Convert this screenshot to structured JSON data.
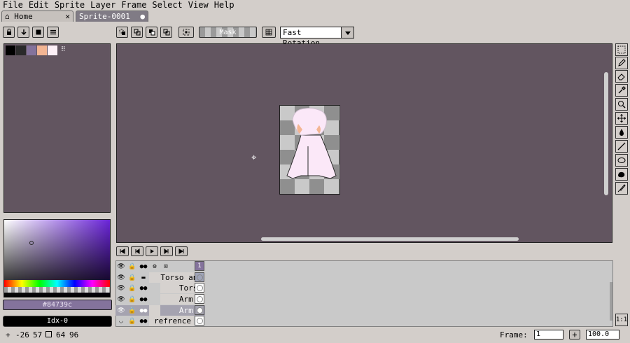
{
  "menu": [
    "File",
    "Edit",
    "Sprite",
    "Layer",
    "Frame",
    "Select",
    "View",
    "Help"
  ],
  "tabs": [
    {
      "label": "Home",
      "close": "✕"
    },
    {
      "label": "Sprite-0001",
      "close": "●"
    }
  ],
  "toolbar": {
    "mask_label": "Mask",
    "rotation_mode": "Fast Rotation"
  },
  "palette": {
    "swatch_colors": [
      "#000000",
      "#2a2a2a",
      "#84739c",
      "#f3b593",
      "#fdf0f7"
    ],
    "more": "⠿"
  },
  "color": {
    "hex": "#84739c",
    "index": "Idx-0"
  },
  "canvas": {
    "background": "#625560",
    "crosshair": "⌖"
  },
  "timeline": {
    "controls": [
      "first-frame",
      "previous-frame",
      "play",
      "next-frame",
      "last-frame"
    ],
    "frame_header": "1",
    "layers": [
      {
        "name": "Torso and",
        "type": "group",
        "selected": false
      },
      {
        "name": "Torso",
        "type": "layer",
        "selected": false
      },
      {
        "name": "Arm A",
        "type": "layer",
        "selected": false
      },
      {
        "name": "Arm B",
        "type": "layer",
        "selected": true
      },
      {
        "name": "refrence",
        "type": "layer",
        "selected": false
      }
    ]
  },
  "status": {
    "cursor_x": "-26",
    "cursor_y": "57",
    "sel_w": "64",
    "sel_h": "96",
    "frame_label": "Frame:",
    "frame_value": "1",
    "zoom": "100.0"
  }
}
